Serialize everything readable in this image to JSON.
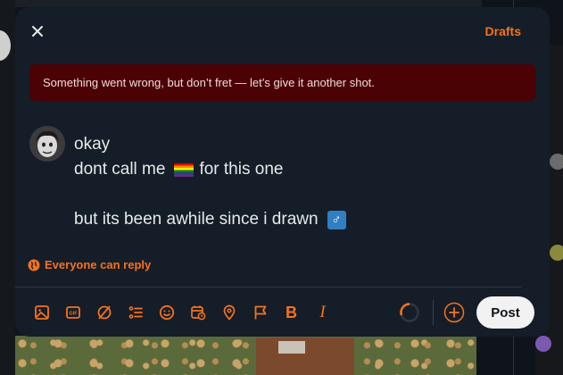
{
  "modal": {
    "drafts_label": "Drafts",
    "error_message": "Something went wrong, but don’t fret — let’s give it another shot.",
    "compose": {
      "line1": "okay",
      "line2_before": "dont call me",
      "line2_after": "for this one",
      "line3": "but its been awhile since i drawn"
    },
    "reply_setting_label": "Everyone can reply",
    "post_label": "Post",
    "accent_color": "#f4731b",
    "error_bg": "#4a0205",
    "icons": [
      "close-icon",
      "image-icon",
      "gif-icon",
      "grok-icon",
      "poll-icon",
      "emoji-icon",
      "schedule-icon",
      "location-icon",
      "flag-icon",
      "bold-icon",
      "italic-icon",
      "progress-ring-icon",
      "add-icon"
    ]
  },
  "toolbar": {
    "bold_label": "B",
    "italic_label": "I"
  }
}
